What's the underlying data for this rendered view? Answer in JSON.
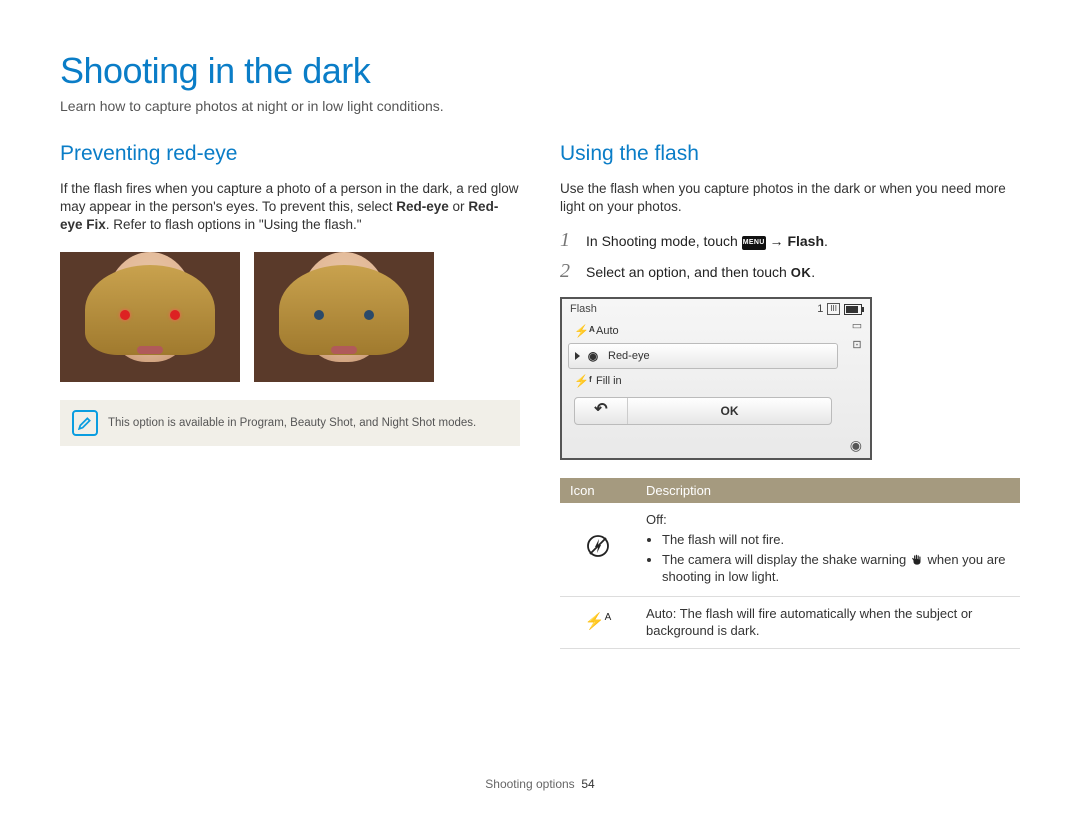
{
  "page": {
    "title": "Shooting in the dark",
    "subtitle": "Learn how to capture photos at night or in low light conditions.",
    "footer_label": "Shooting options",
    "footer_page": "54"
  },
  "left": {
    "heading": "Preventing red-eye",
    "para_before": "If the flash fires when you capture a photo of a person in the dark, a red glow may appear in the person's eyes. To prevent this, select ",
    "bold1": "Red-eye",
    "para_mid": " or ",
    "bold2": "Red-eye Fix",
    "para_after": ". Refer to flash options in \"Using the flash.\"",
    "note": "This option is available in Program, Beauty Shot, and Night Shot modes."
  },
  "right": {
    "heading": "Using the flash",
    "intro": "Use the flash when you capture photos in the dark or when you need more light on your photos.",
    "step1_before": "In Shooting mode, touch ",
    "step1_menu": "MENU",
    "step1_arrow": " → ",
    "step1_bold": "Flash",
    "step1_after": ".",
    "step2_before": "Select an option, and then touch ",
    "step2_ok": "OK",
    "step2_after": "."
  },
  "screen": {
    "title": "Flash",
    "count": "1",
    "items": [
      {
        "icon": "⚡ᴬ",
        "label": "Auto"
      },
      {
        "icon": "◉",
        "label": "Red-eye"
      },
      {
        "icon": "⚡ᶠ",
        "label": "Fill in"
      }
    ],
    "back": "↶",
    "ok": "OK"
  },
  "table": {
    "col_icon": "Icon",
    "col_desc": "Description",
    "rows": [
      {
        "icon": "off",
        "title": "Off",
        "bullets": [
          "The flash will not fire.",
          "The camera will display the shake warning {hand} when you are shooting in low light."
        ]
      },
      {
        "icon": "auto",
        "title": "Auto",
        "text": ": The flash will fire automatically when the subject or background is dark."
      }
    ]
  }
}
